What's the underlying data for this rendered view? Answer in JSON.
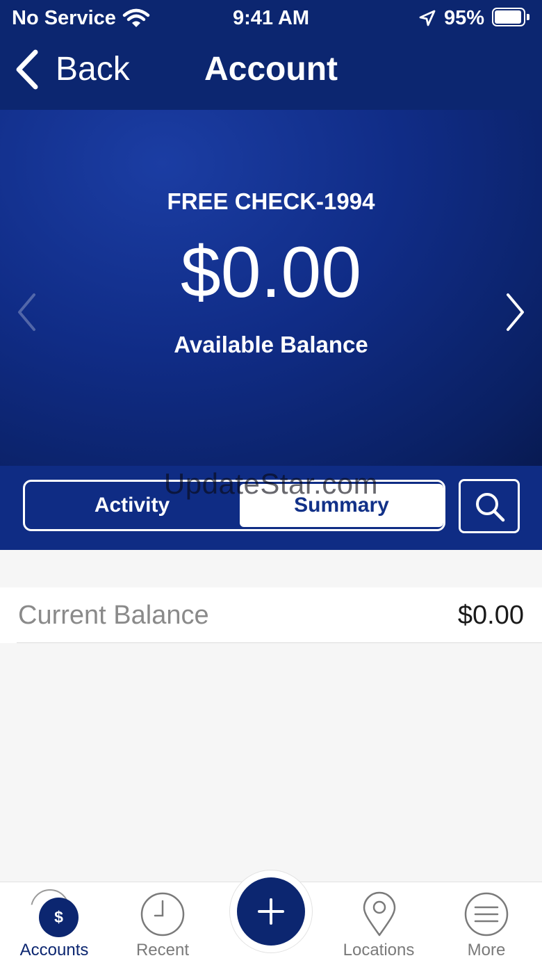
{
  "status_bar": {
    "carrier": "No Service",
    "time": "9:41 AM",
    "battery_percent": "95%",
    "battery_level": 0.95
  },
  "nav": {
    "back_label": "Back",
    "title": "Account"
  },
  "account": {
    "name": "FREE CHECK-1994",
    "balance": "$0.00",
    "balance_label": "Available Balance"
  },
  "segments": {
    "activity": "Activity",
    "summary": "Summary",
    "selected": "Summary"
  },
  "watermark": "UpdateStar.com",
  "summary": {
    "rows": [
      {
        "label": "Current Balance",
        "value": "$0.00"
      }
    ]
  },
  "tab_bar": {
    "items": [
      {
        "label": "Accounts",
        "icon": "dollar-icon"
      },
      {
        "label": "Recent",
        "icon": "clock-icon"
      },
      {
        "label": "",
        "icon": "plus-icon"
      },
      {
        "label": "Locations",
        "icon": "location-pin-icon"
      },
      {
        "label": "More",
        "icon": "menu-icon"
      }
    ],
    "selected": "Accounts"
  },
  "colors": {
    "brand_navy": "#0c2670",
    "hero_blue": "#102c86",
    "text_muted": "#7a7a7a"
  }
}
